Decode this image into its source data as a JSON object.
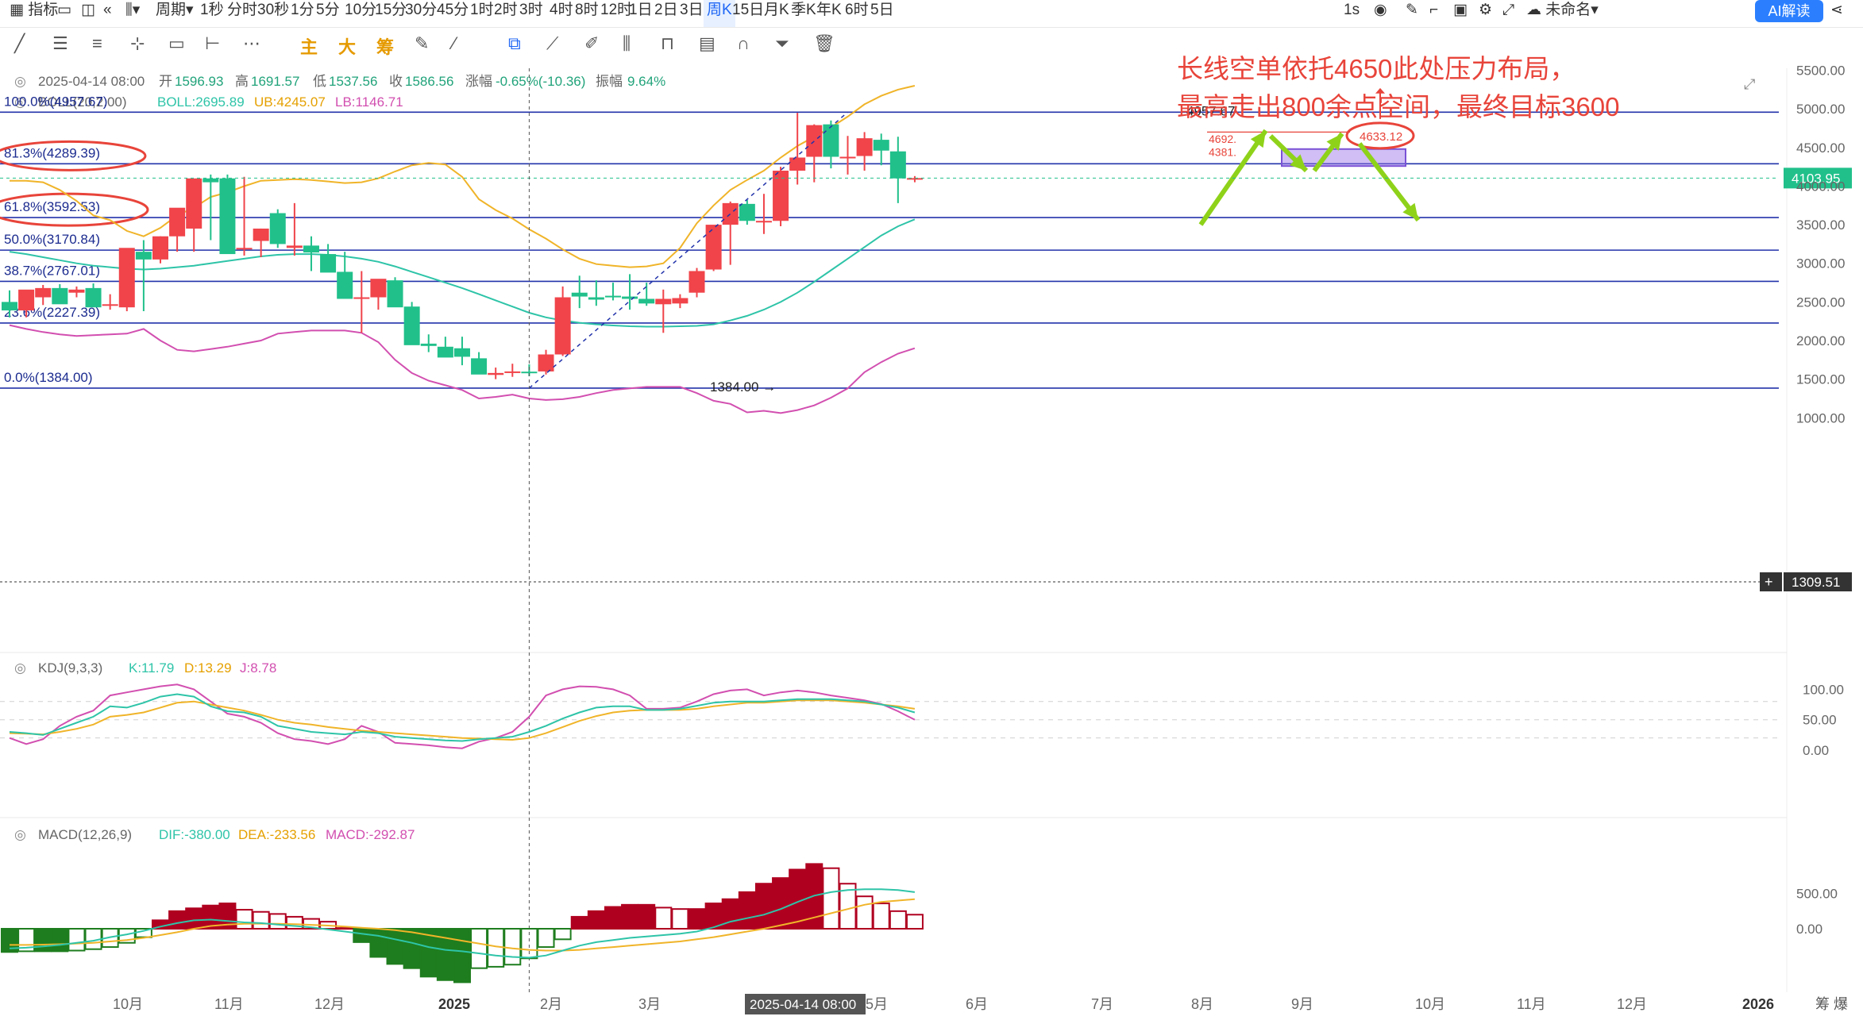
{
  "toolbar": {
    "indicator_label": "指标",
    "period_label": "周期",
    "intervals": [
      "1秒",
      "分时",
      "30秒",
      "1分",
      "5分",
      "10分",
      "15分",
      "30分",
      "45分",
      "1时",
      "2时",
      "3时",
      "4时",
      "8时",
      "12时",
      "1日",
      "2日",
      "3日",
      "周K",
      "15日",
      "月K",
      "季K",
      "年K",
      "6时",
      "5日"
    ],
    "active_interval": "周K",
    "refresh": "1s",
    "unnamed": "未命名",
    "ai_button": "AI解读"
  },
  "drawing_tools": [
    "主",
    "大",
    "筹"
  ],
  "info": {
    "date": "2025-04-14 08:00",
    "open_label": "开",
    "open": "1596.93",
    "high_label": "高",
    "high": "1691.57",
    "low_label": "低",
    "low": "1537.56",
    "close_label": "收",
    "close": "1586.56",
    "change_label": "涨幅",
    "change": "-0.65%(-10.36)",
    "amp_label": "振幅",
    "amp": "9.64%"
  },
  "boll": {
    "title": "BOLL(20,2.00)",
    "mid": "BOLL:2695.89",
    "ub": "UB:4245.07",
    "lb": "LB:1146.71"
  },
  "kdj": {
    "title": "KDJ(9,3,3)",
    "k": "K:11.79",
    "d": "D:13.29",
    "j": "J:8.78"
  },
  "macd": {
    "title": "MACD(12,26,9)",
    "dif": "DIF:-380.00",
    "dea": "DEA:-233.56",
    "macd": "MACD:-292.87"
  },
  "annotation": {
    "line1": "长线空单依托4650此处压力布局，",
    "line2": "最高走出800余点空间，最终目标3600",
    "color": "#e8443a"
  },
  "price_labels": {
    "current": "4103.95",
    "cursor": "1309.51",
    "high_mark": "4957.67",
    "low_mark": "1384.00",
    "circled": "4633.12",
    "small_a": "4692.",
    "small_b": "4381."
  },
  "crosshair_date": "2025-04-14 08:00",
  "corner_label": "筹 爆",
  "colors": {
    "up": "#f0444a",
    "down": "#21c08b",
    "boll_mid": "#2ec4a8",
    "boll_ub": "#f0b429",
    "boll_lb": "#d24fb0",
    "fib": "#2233aa",
    "arrow": "#8fd21a",
    "macd_up": "#b00020",
    "macd_down": "#1e7d1e"
  },
  "chart_data": {
    "type": "candlestick",
    "interval": "weekly",
    "x": [
      "2024-09-09",
      "2024-09-16",
      "2024-09-23",
      "2024-09-30",
      "2024-10-07",
      "2024-10-14",
      "2024-10-21",
      "2024-10-28",
      "2024-11-04",
      "2024-11-11",
      "2024-11-18",
      "2024-11-25",
      "2024-12-02",
      "2024-12-09",
      "2024-12-16",
      "2024-12-23",
      "2024-12-30",
      "2025-01-06",
      "2025-01-13",
      "2025-01-20",
      "2025-01-27",
      "2025-02-03",
      "2025-02-10",
      "2025-02-17",
      "2025-02-24",
      "2025-03-03",
      "2025-03-10",
      "2025-03-17",
      "2025-03-24",
      "2025-03-31",
      "2025-04-07",
      "2025-04-14",
      "2025-04-21",
      "2025-04-28",
      "2025-05-05",
      "2025-05-12",
      "2025-05-19",
      "2025-05-26",
      "2025-06-02",
      "2025-06-09",
      "2025-06-16",
      "2025-06-23",
      "2025-06-30",
      "2025-07-07",
      "2025-07-14",
      "2025-07-21",
      "2025-07-28",
      "2025-08-04",
      "2025-08-11",
      "2025-08-18",
      "2025-08-25",
      "2025-09-01",
      "2025-09-08",
      "2025-09-15",
      "2025-09-22"
    ],
    "open": [
      2500,
      2390,
      2560,
      2680,
      2620,
      2680,
      2450,
      2430,
      3150,
      3050,
      3350,
      3450,
      4100,
      4100,
      3200,
      3290,
      3650,
      3200,
      3230,
      3120,
      2890,
      2540,
      2560,
      2780,
      2440,
      1960,
      1920,
      1900,
      1770,
      1555,
      1588,
      1597,
      1600,
      1820,
      2620,
      2560,
      2580,
      2570,
      2540,
      2470,
      2480,
      2620,
      2920,
      3500,
      3770,
      3550,
      3550,
      4200,
      4380,
      4800,
      4380,
      4390,
      4600,
      4450,
      4100
    ],
    "high": [
      2650,
      2650,
      2720,
      2730,
      2700,
      2740,
      2600,
      2500,
      3300,
      3350,
      3450,
      3850,
      4150,
      4150,
      4120,
      3450,
      3700,
      3780,
      3350,
      3250,
      3150,
      2900,
      2780,
      2820,
      2500,
      2080,
      2050,
      2050,
      1850,
      1650,
      1700,
      1692,
      1880,
      2700,
      2840,
      2780,
      2750,
      2860,
      2750,
      2660,
      2600,
      2940,
      3050,
      3800,
      3820,
      3900,
      4250,
      4950,
      4800,
      4850,
      4650,
      4700,
      4680,
      4640,
      4130
    ],
    "low": [
      2300,
      2300,
      2460,
      2560,
      2560,
      2520,
      2400,
      2380,
      2380,
      3000,
      3150,
      3150,
      3300,
      3150,
      3100,
      3080,
      3200,
      3100,
      2900,
      3100,
      2730,
      2100,
      2400,
      2470,
      2020,
      1850,
      1800,
      1680,
      1700,
      1500,
      1530,
      1538,
      1560,
      1800,
      2420,
      2450,
      2520,
      2400,
      2450,
      2100,
      2420,
      2560,
      2900,
      2980,
      3500,
      3380,
      3480,
      4020,
      4050,
      4230,
      4150,
      4200,
      4270,
      3780,
      4050
    ],
    "close": [
      2390,
      2660,
      2680,
      2470,
      2660,
      2430,
      2470,
      3200,
      3050,
      3350,
      3720,
      4100,
      4050,
      3120,
      3200,
      3450,
      3250,
      3230,
      3140,
      2880,
      2540,
      2560,
      2800,
      2430,
      1940,
      1930,
      1780,
      1790,
      1560,
      1580,
      1600,
      1587,
      1820,
      2560,
      2570,
      2530,
      2570,
      2540,
      2480,
      2540,
      2550,
      2900,
      3500,
      3780,
      3550,
      3550,
      4200,
      4370,
      4790,
      4380,
      4380,
      4620,
      4460,
      4100,
      4104
    ],
    "boll_mid": [
      3150,
      3120,
      3080,
      3040,
      3000,
      2970,
      2950,
      2930,
      2920,
      2930,
      2950,
      2970,
      3000,
      3030,
      3060,
      3090,
      3110,
      3120,
      3120,
      3110,
      3090,
      3060,
      3020,
      2960,
      2890,
      2820,
      2750,
      2680,
      2600,
      2520,
      2440,
      2360,
      2300,
      2260,
      2230,
      2210,
      2195,
      2185,
      2180,
      2180,
      2185,
      2190,
      2210,
      2260,
      2320,
      2400,
      2500,
      2620,
      2760,
      2910,
      3060,
      3210,
      3360,
      3480,
      3570
    ],
    "boll_ub": [
      4070,
      4070,
      4050,
      3950,
      3810,
      3620,
      3560,
      3420,
      3350,
      3460,
      3620,
      3720,
      3860,
      3920,
      4000,
      4070,
      4080,
      4090,
      4080,
      4060,
      4040,
      4050,
      4100,
      4190,
      4270,
      4300,
      4280,
      4120,
      3830,
      3690,
      3580,
      3440,
      3320,
      3180,
      3060,
      2990,
      2970,
      2950,
      2960,
      3000,
      3200,
      3520,
      3750,
      3950,
      4080,
      4200,
      4370,
      4520,
      4640,
      4760,
      4900,
      5060,
      5170,
      5250,
      5300
    ],
    "boll_lb": [
      2200,
      2150,
      2110,
      2080,
      2060,
      2070,
      2080,
      2090,
      2150,
      2000,
      1880,
      1860,
      1890,
      1920,
      1960,
      2000,
      2090,
      2110,
      2130,
      2130,
      2130,
      2100,
      1980,
      1750,
      1580,
      1480,
      1420,
      1360,
      1250,
      1270,
      1300,
      1250,
      1230,
      1240,
      1270,
      1320,
      1360,
      1380,
      1400,
      1400,
      1400,
      1320,
      1220,
      1180,
      1070,
      1090,
      1060,
      1100,
      1160,
      1260,
      1380,
      1590,
      1720,
      1830,
      1900
    ],
    "kdj_k": [
      30,
      28,
      25,
      35,
      45,
      55,
      72,
      70,
      78,
      88,
      92,
      88,
      72,
      64,
      62,
      55,
      40,
      35,
      30,
      28,
      26,
      30,
      28,
      22,
      20,
      18,
      16,
      15,
      18,
      20,
      22,
      30,
      40,
      52,
      62,
      70,
      72,
      72,
      66,
      66,
      68,
      73,
      78,
      80,
      80,
      80,
      82,
      84,
      84,
      84,
      82,
      80,
      75,
      70,
      62
    ],
    "kdj_d": [
      28,
      27,
      26,
      30,
      35,
      42,
      55,
      58,
      62,
      70,
      78,
      80,
      75,
      70,
      65,
      58,
      50,
      45,
      42,
      38,
      35,
      32,
      30,
      28,
      26,
      24,
      22,
      20,
      19,
      18,
      17,
      20,
      28,
      38,
      48,
      56,
      62,
      65,
      66,
      66,
      66,
      68,
      72,
      75,
      78,
      78,
      80,
      82,
      82,
      82,
      80,
      78,
      75,
      72,
      68
    ],
    "kdj_j": [
      20,
      10,
      18,
      40,
      55,
      65,
      90,
      95,
      100,
      105,
      108,
      100,
      80,
      60,
      55,
      45,
      28,
      18,
      15,
      10,
      18,
      40,
      30,
      12,
      10,
      8,
      5,
      3,
      14,
      20,
      30,
      55,
      90,
      100,
      105,
      104,
      100,
      90,
      68,
      68,
      70,
      80,
      92,
      98,
      100,
      90,
      95,
      98,
      95,
      90,
      86,
      82,
      76,
      64,
      50
    ],
    "dif": [
      -280,
      -270,
      -250,
      -230,
      -200,
      -170,
      -120,
      -80,
      -30,
      30,
      80,
      120,
      130,
      110,
      90,
      80,
      60,
      40,
      20,
      -10,
      -40,
      -70,
      -100,
      -150,
      -200,
      -260,
      -300,
      -320,
      -350,
      -380,
      -400,
      -410,
      -380,
      -310,
      -240,
      -190,
      -160,
      -130,
      -110,
      -90,
      -70,
      -40,
      20,
      100,
      150,
      200,
      280,
      380,
      470,
      520,
      550,
      560,
      560,
      550,
      520
    ],
    "dea": [
      -230,
      -230,
      -225,
      -220,
      -210,
      -200,
      -180,
      -160,
      -130,
      -90,
      -50,
      0,
      40,
      60,
      70,
      72,
      70,
      65,
      55,
      45,
      30,
      15,
      0,
      -20,
      -50,
      -90,
      -130,
      -170,
      -210,
      -250,
      -280,
      -300,
      -310,
      -310,
      -300,
      -280,
      -260,
      -240,
      -220,
      -200,
      -180,
      -150,
      -120,
      -80,
      -40,
      0,
      50,
      100,
      160,
      220,
      280,
      340,
      380,
      400,
      420
    ],
    "macd_hist": [
      -330,
      -320,
      -320,
      -320,
      -310,
      -290,
      -260,
      -200,
      -120,
      120,
      250,
      290,
      330,
      360,
      270,
      240,
      210,
      170,
      140,
      100,
      10,
      -190,
      -400,
      -500,
      -560,
      -680,
      -730,
      -760,
      -560,
      -540,
      -510,
      -420,
      -260,
      -150,
      170,
      250,
      310,
      340,
      340,
      300,
      280,
      280,
      360,
      420,
      520,
      640,
      720,
      840,
      920,
      860,
      640,
      460,
      360,
      250,
      200
    ]
  }
}
